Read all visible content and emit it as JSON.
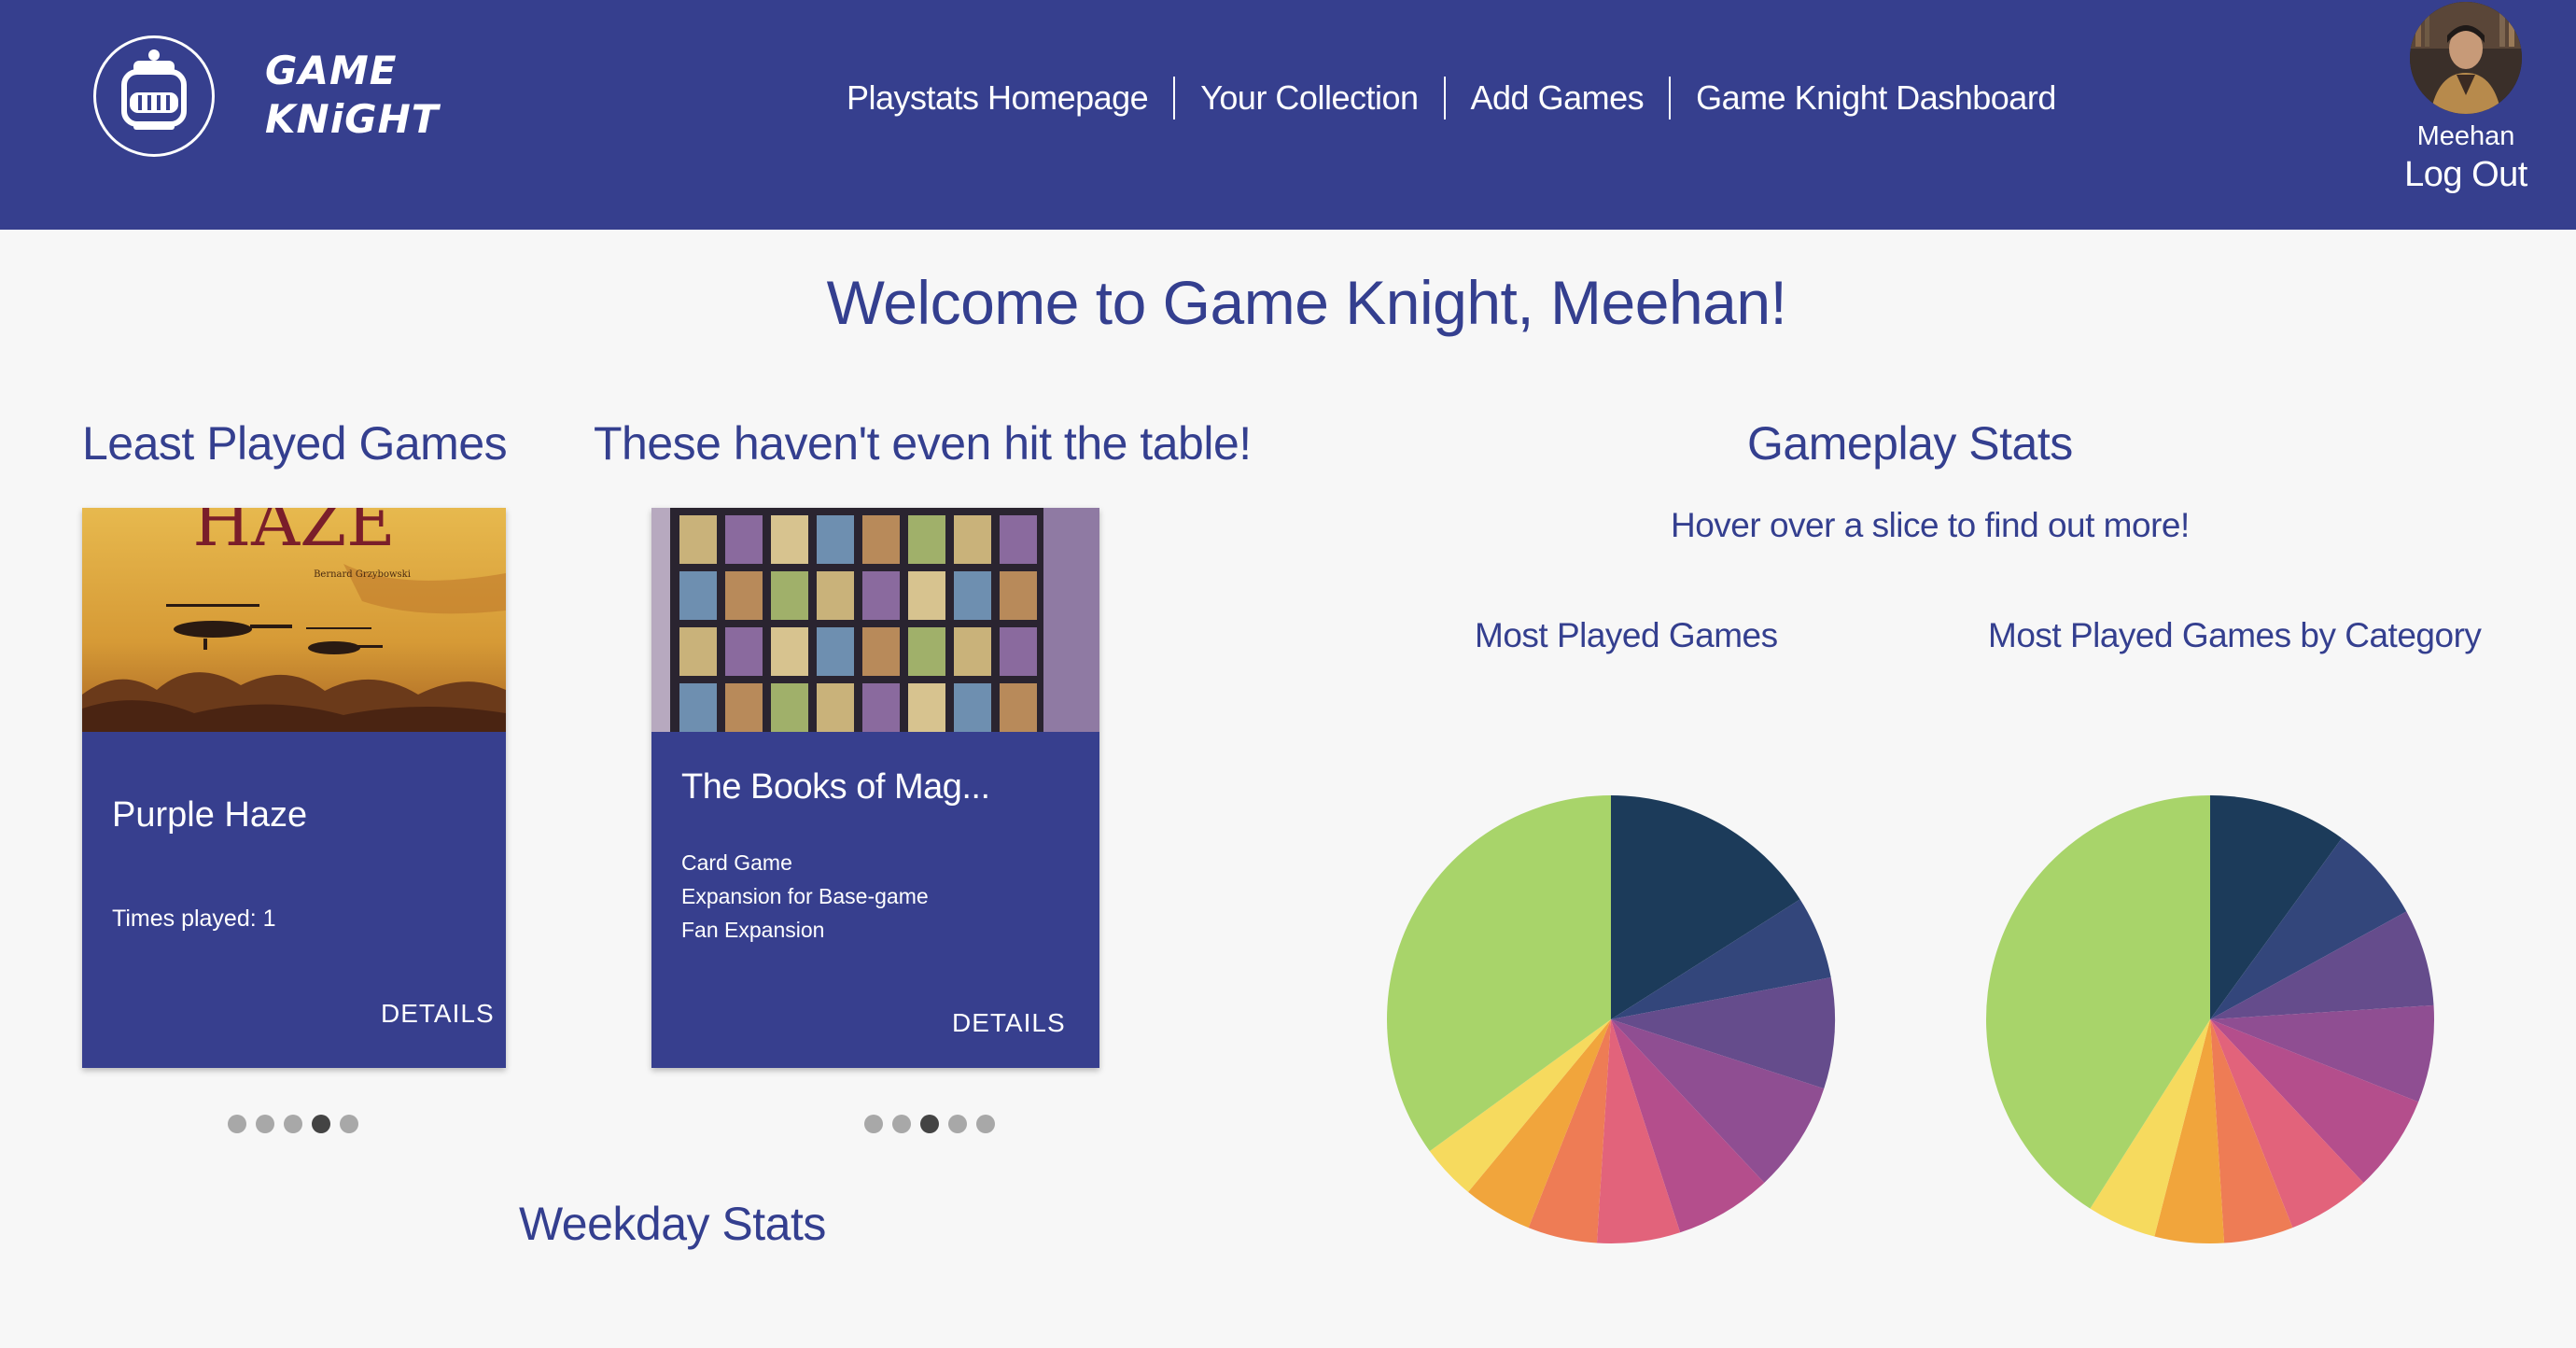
{
  "header": {
    "logo_line1": "GAME",
    "logo_line2": "KNiGHT",
    "nav": [
      "Playstats Homepage",
      "Your Collection",
      "Add Games",
      "Game Knight Dashboard"
    ],
    "user_name": "Meehan",
    "logout_label": "Log Out"
  },
  "welcome": "Welcome to Game Knight, Meehan!",
  "least_played": {
    "heading": "Least Played Games",
    "card": {
      "image_title": "HAZE",
      "image_author": "Bernard Grzybowski",
      "title": "Purple Haze",
      "times_played": "Times played: 1",
      "button": "DETAILS"
    },
    "dots_total": 5,
    "dots_active": 4
  },
  "not_played": {
    "heading": "These haven't even hit the table!",
    "card": {
      "title": "The Books of Mag...",
      "categories": [
        "Card Game",
        "Expansion for Base-game",
        "Fan Expansion"
      ],
      "button": "DETAILS"
    },
    "dots_total": 5,
    "dots_active": 3
  },
  "weekday": {
    "heading": "Weekday Stats"
  },
  "gameplay": {
    "heading": "Gameplay Stats",
    "hint": "Hover over a slice to find out more!",
    "pie1_title": "Most Played Games",
    "pie2_title": "Most Played Games by Category"
  },
  "chart_data": [
    {
      "type": "pie",
      "title": "Most Played Games",
      "values": [
        16,
        6,
        8,
        8,
        7,
        6,
        5,
        5,
        4,
        35
      ],
      "colors": [
        "#1c3b5a",
        "#33467b",
        "#654c8c",
        "#8f4e92",
        "#b44e8c",
        "#e2637b",
        "#ee7c55",
        "#f1a53c",
        "#f6da5e",
        "#a8d46a"
      ]
    },
    {
      "type": "pie",
      "title": "Most Played Games by Category",
      "values": [
        10,
        7,
        7,
        7,
        7,
        6,
        5,
        5,
        5,
        41
      ],
      "colors": [
        "#1c3b5a",
        "#33467b",
        "#654c8c",
        "#8f4e92",
        "#b44e8c",
        "#e2637b",
        "#ee7c55",
        "#f1a53c",
        "#f6da5e",
        "#a8d46a"
      ]
    }
  ]
}
